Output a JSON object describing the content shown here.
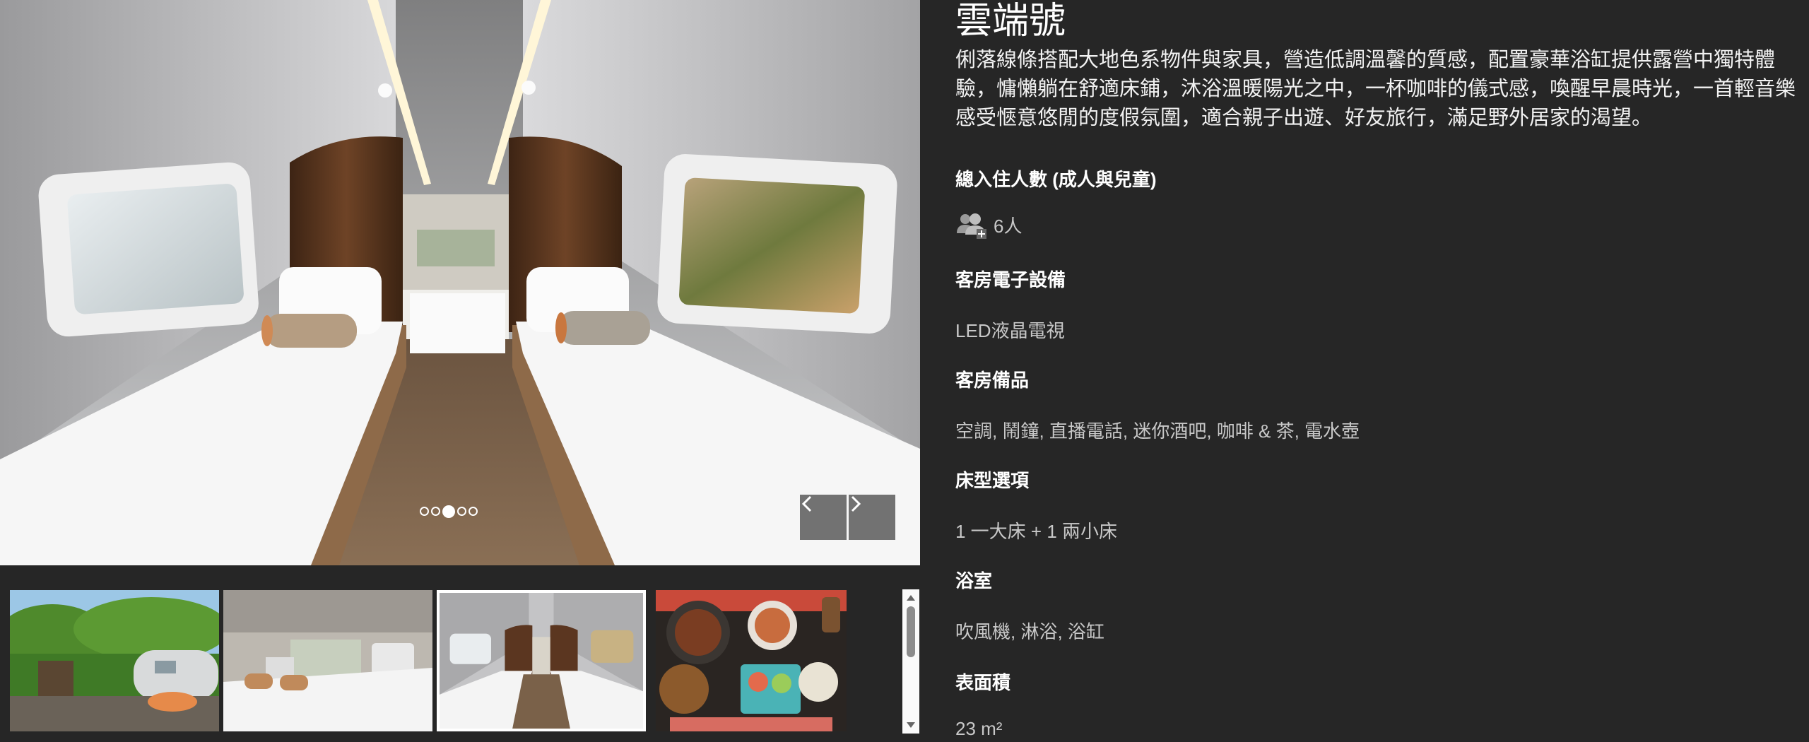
{
  "gallery": {
    "dot_count": 5,
    "active_dot": 2,
    "prev_label": "‹",
    "next_label": "›",
    "thumbnails": [
      {
        "scene": "exterior-trailer-garden"
      },
      {
        "scene": "interior-bedroom-wide"
      },
      {
        "scene": "interior-bedroom-twin",
        "selected": true
      },
      {
        "scene": "hotpot-meal"
      }
    ]
  },
  "room": {
    "title": "雲端號",
    "description": "俐落線條搭配大地色系物件與家具，營造低調溫馨的質感，配置豪華浴缸提供露營中獨特體驗，慵懶躺在舒適床鋪，沐浴溫暖陽光之中，一杯咖啡的儀式感，喚醒早晨時光，一首輕音樂感受愜意悠閒的度假氛圍，適合親子出遊、好友旅行，滿足野外居家的渴望。",
    "occupancy": {
      "heading": "總入住人數 (成人與兒童)",
      "value": "6人",
      "icon": "users-icon"
    },
    "electronics": {
      "heading": "客房電子設備",
      "value": "LED液晶電視"
    },
    "amenities": {
      "heading": "客房備品",
      "value": "空調, 鬧鐘, 直播電話, 迷你酒吧, 咖啡 & 茶, 電水壺"
    },
    "bed": {
      "heading": "床型選項",
      "value": "1 一大床 + 1 兩小床"
    },
    "bathroom": {
      "heading": "浴室",
      "value": "吹風機, 淋浴, 浴缸"
    },
    "area": {
      "heading": "表面積",
      "value": "23 m²"
    }
  },
  "colors": {
    "background": "#262626",
    "heading": "#ffffff",
    "value": "#c8c8c8"
  }
}
